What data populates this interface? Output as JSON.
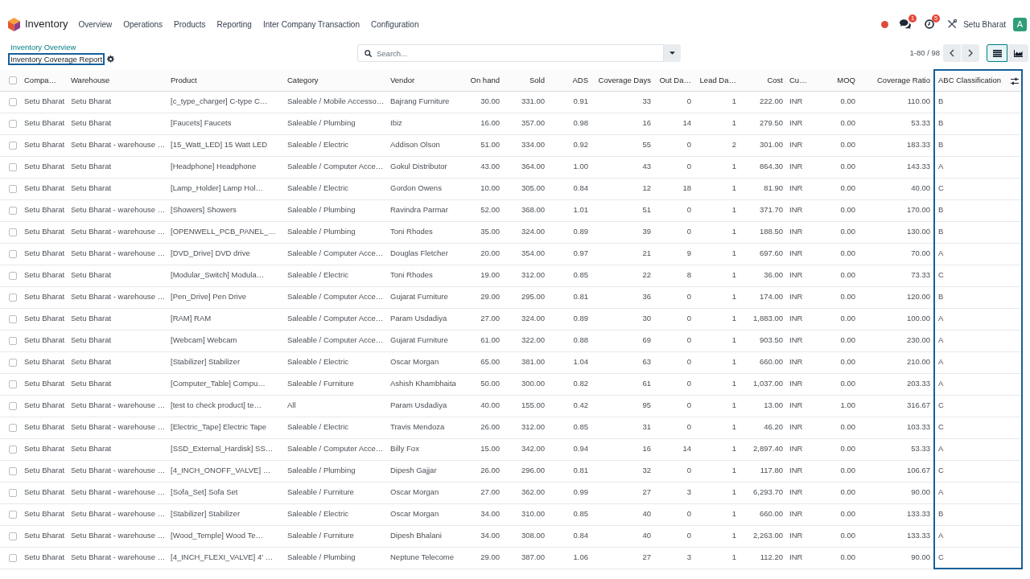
{
  "navbar": {
    "app_name": "Inventory",
    "menu": [
      "Overview",
      "Operations",
      "Products",
      "Reporting",
      "Inter Company Transaction",
      "Configuration"
    ],
    "systray": [
      {
        "kind": "status_dot"
      },
      {
        "kind": "messages",
        "badge": "1"
      },
      {
        "kind": "activities",
        "badge": "5"
      },
      {
        "kind": "debug_tools"
      }
    ],
    "company": "Setu Bharat",
    "avatar": "A"
  },
  "breadcrumb": [
    {
      "label": "Inventory Overview",
      "current": false,
      "highlighted": false
    },
    {
      "label": "Inventory Coverage Report",
      "current": true,
      "highlighted": true
    }
  ],
  "search": {
    "placeholder": "Search..."
  },
  "pager": {
    "range": "1-80 / 98"
  },
  "views": [
    {
      "kind": "list",
      "selected": true
    },
    {
      "kind": "graph",
      "selected": false
    }
  ],
  "table": {
    "all_selected": false,
    "columns": [
      {
        "label": "Compa…",
        "kind": "text",
        "highlighted": false
      },
      {
        "label": "Warehouse",
        "kind": "text",
        "highlighted": false
      },
      {
        "label": "Product",
        "kind": "text",
        "highlighted": false
      },
      {
        "label": "Category",
        "kind": "text",
        "highlighted": false
      },
      {
        "label": "Vendor",
        "kind": "text",
        "highlighted": false
      },
      {
        "label": "On hand",
        "kind": "number",
        "highlighted": false
      },
      {
        "label": "Sold",
        "kind": "number",
        "highlighted": false
      },
      {
        "label": "ADS",
        "kind": "number",
        "highlighted": false
      },
      {
        "label": "Coverage Days",
        "kind": "number",
        "highlighted": false
      },
      {
        "label": "Out Da…",
        "kind": "number",
        "highlighted": false
      },
      {
        "label": "Lead Da…",
        "kind": "number",
        "highlighted": false
      },
      {
        "label": "Cost",
        "kind": "number",
        "highlighted": false
      },
      {
        "label": "Cu…",
        "kind": "text",
        "highlighted": false
      },
      {
        "label": "MOQ",
        "kind": "number",
        "highlighted": false
      },
      {
        "label": "Coverage Ratio",
        "kind": "number",
        "highlighted": false
      },
      {
        "label": "ABC Classification",
        "kind": "text",
        "highlighted": true
      }
    ],
    "rows": [
      {
        "selected": false,
        "cells": [
          "Setu Bharat",
          "Setu Bharat",
          "[c_type_charger] C-type C…",
          "Saleable / Mobile Accesso…",
          "Bajrang Furniture",
          "30.00",
          "331.00",
          "0.91",
          "33",
          "0",
          "1",
          "222.00",
          "INR",
          "0.00",
          "110.00",
          "B"
        ]
      },
      {
        "selected": false,
        "cells": [
          "Setu Bharat",
          "Setu Bharat",
          "[Faucets] Faucets",
          "Saleable / Plumbing",
          "Ibiz",
          "16.00",
          "357.00",
          "0.98",
          "16",
          "14",
          "1",
          "279.50",
          "INR",
          "0.00",
          "53.33",
          "B"
        ]
      },
      {
        "selected": false,
        "cells": [
          "Setu Bharat",
          "Setu Bharat - warehouse …",
          "[15_Watt_LED] 15 Watt LED",
          "Saleable / Electric",
          "Addison Olson",
          "51.00",
          "334.00",
          "0.92",
          "55",
          "0",
          "2",
          "301.00",
          "INR",
          "0.00",
          "183.33",
          "B"
        ]
      },
      {
        "selected": false,
        "cells": [
          "Setu Bharat",
          "Setu Bharat",
          "[Headphone] Headphone",
          "Saleable / Computer Acce…",
          "Gokul Distributor",
          "43.00",
          "364.00",
          "1.00",
          "43",
          "0",
          "1",
          "864.30",
          "INR",
          "0.00",
          "143.33",
          "A"
        ]
      },
      {
        "selected": false,
        "cells": [
          "Setu Bharat",
          "Setu Bharat",
          "[Lamp_Holder] Lamp Hol…",
          "Saleable / Electric",
          "Gordon Owens",
          "10.00",
          "305.00",
          "0.84",
          "12",
          "18",
          "1",
          "81.90",
          "INR",
          "0.00",
          "40.00",
          "C"
        ]
      },
      {
        "selected": false,
        "cells": [
          "Setu Bharat",
          "Setu Bharat - warehouse …",
          "[Showers] Showers",
          "Saleable / Plumbing",
          "Ravindra Parmar",
          "52.00",
          "368.00",
          "1.01",
          "51",
          "0",
          "1",
          "371.70",
          "INR",
          "0.00",
          "170.00",
          "B"
        ]
      },
      {
        "selected": false,
        "cells": [
          "Setu Bharat",
          "Setu Bharat - warehouse …",
          "[OPENWELL_PCB_PANEL_…",
          "Saleable / Plumbing",
          "Toni Rhodes",
          "35.00",
          "324.00",
          "0.89",
          "39",
          "0",
          "1",
          "188.50",
          "INR",
          "0.00",
          "130.00",
          "B"
        ]
      },
      {
        "selected": false,
        "cells": [
          "Setu Bharat",
          "Setu Bharat - warehouse …",
          "[DVD_Drive] DVD drive",
          "Saleable / Computer Acce…",
          "Douglas Fletcher",
          "20.00",
          "354.00",
          "0.97",
          "21",
          "9",
          "1",
          "697.60",
          "INR",
          "0.00",
          "70.00",
          "A"
        ]
      },
      {
        "selected": false,
        "cells": [
          "Setu Bharat",
          "Setu Bharat",
          "[Modular_Switch] Modula…",
          "Saleable / Electric",
          "Toni Rhodes",
          "19.00",
          "312.00",
          "0.85",
          "22",
          "8",
          "1",
          "36.00",
          "INR",
          "0.00",
          "73.33",
          "C"
        ]
      },
      {
        "selected": false,
        "cells": [
          "Setu Bharat",
          "Setu Bharat - warehouse …",
          "[Pen_Drive] Pen Drive",
          "Saleable / Computer Acce…",
          "Gujarat Furniture",
          "29.00",
          "295.00",
          "0.81",
          "36",
          "0",
          "1",
          "174.00",
          "INR",
          "0.00",
          "120.00",
          "B"
        ]
      },
      {
        "selected": false,
        "cells": [
          "Setu Bharat",
          "Setu Bharat",
          "[RAM] RAM",
          "Saleable / Computer Acce…",
          "Param Usdadiya",
          "27.00",
          "324.00",
          "0.89",
          "30",
          "0",
          "1",
          "1,883.00",
          "INR",
          "0.00",
          "100.00",
          "A"
        ]
      },
      {
        "selected": false,
        "cells": [
          "Setu Bharat",
          "Setu Bharat",
          "[Webcam] Webcam",
          "Saleable / Computer Acce…",
          "Gujarat Furniture",
          "61.00",
          "322.00",
          "0.88",
          "69",
          "0",
          "1",
          "903.50",
          "INR",
          "0.00",
          "230.00",
          "A"
        ]
      },
      {
        "selected": false,
        "cells": [
          "Setu Bharat",
          "Setu Bharat",
          "[Stabilizer] Stabilizer",
          "Saleable / Electric",
          "Oscar Morgan",
          "65.00",
          "381.00",
          "1.04",
          "63",
          "0",
          "1",
          "660.00",
          "INR",
          "0.00",
          "210.00",
          "A"
        ]
      },
      {
        "selected": false,
        "cells": [
          "Setu Bharat",
          "Setu Bharat",
          "[Computer_Table] Compu…",
          "Saleable / Furniture",
          "Ashish Khambhaita",
          "50.00",
          "300.00",
          "0.82",
          "61",
          "0",
          "1",
          "1,037.00",
          "INR",
          "0.00",
          "203.33",
          "A"
        ]
      },
      {
        "selected": false,
        "cells": [
          "Setu Bharat",
          "Setu Bharat - warehouse …",
          "[test to check product] te…",
          "All",
          "Param Usdadiya",
          "40.00",
          "155.00",
          "0.42",
          "95",
          "0",
          "1",
          "13.00",
          "INR",
          "1.00",
          "316.67",
          "C"
        ]
      },
      {
        "selected": false,
        "cells": [
          "Setu Bharat",
          "Setu Bharat - warehouse …",
          "[Electric_Tape] Electric Tape",
          "Saleable / Electric",
          "Travis Mendoza",
          "26.00",
          "312.00",
          "0.85",
          "31",
          "0",
          "1",
          "46.20",
          "INR",
          "0.00",
          "103.33",
          "C"
        ]
      },
      {
        "selected": false,
        "cells": [
          "Setu Bharat",
          "Setu Bharat",
          "[SSD_External_Hardisk] SS…",
          "Saleable / Computer Acce…",
          "Billy Fox",
          "15.00",
          "342.00",
          "0.94",
          "16",
          "14",
          "1",
          "2,897.40",
          "INR",
          "0.00",
          "53.33",
          "A"
        ]
      },
      {
        "selected": false,
        "cells": [
          "Setu Bharat",
          "Setu Bharat - warehouse …",
          "[4_INCH_ONOFF_VALVE] …",
          "Saleable / Plumbing",
          "Dipesh Gajjar",
          "26.00",
          "296.00",
          "0.81",
          "32",
          "0",
          "1",
          "117.80",
          "INR",
          "0.00",
          "106.67",
          "C"
        ]
      },
      {
        "selected": false,
        "cells": [
          "Setu Bharat",
          "Setu Bharat - warehouse …",
          "[Sofa_Set] Sofa Set",
          "Saleable / Furniture",
          "Oscar Morgan",
          "27.00",
          "362.00",
          "0.99",
          "27",
          "3",
          "1",
          "6,293.70",
          "INR",
          "0.00",
          "90.00",
          "A"
        ]
      },
      {
        "selected": false,
        "cells": [
          "Setu Bharat",
          "Setu Bharat - warehouse …",
          "[Stabilizer] Stabilizer",
          "Saleable / Electric",
          "Oscar Morgan",
          "34.00",
          "310.00",
          "0.85",
          "40",
          "0",
          "1",
          "660.00",
          "INR",
          "0.00",
          "133.33",
          "B"
        ]
      },
      {
        "selected": false,
        "cells": [
          "Setu Bharat",
          "Setu Bharat - warehouse …",
          "[Wood_Temple] Wood Te…",
          "Saleable / Furniture",
          "Dipesh Bhalani",
          "34.00",
          "308.00",
          "0.84",
          "40",
          "0",
          "1",
          "2,263.00",
          "INR",
          "0.00",
          "133.33",
          "A"
        ]
      },
      {
        "selected": false,
        "cells": [
          "Setu Bharat",
          "Setu Bharat - warehouse …",
          "[4_INCH_FLEXI_VALVE] 4' …",
          "Saleable / Plumbing",
          "Neptune Telecome",
          "29.00",
          "387.00",
          "1.06",
          "27",
          "3",
          "1",
          "112.20",
          "INR",
          "0.00",
          "90.00",
          "C"
        ]
      }
    ]
  }
}
